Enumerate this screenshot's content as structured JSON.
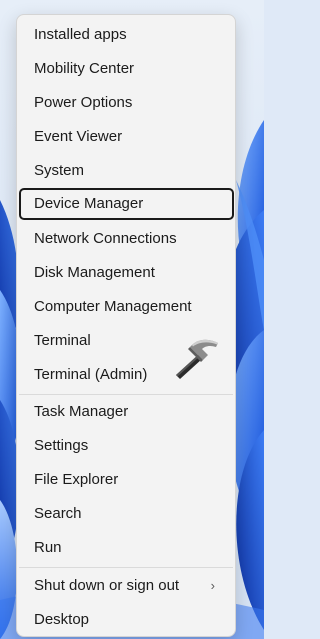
{
  "menu": {
    "items": [
      {
        "label": "Installed apps"
      },
      {
        "label": "Mobility Center"
      },
      {
        "label": "Power Options"
      },
      {
        "label": "Event Viewer"
      },
      {
        "label": "System"
      },
      {
        "label": "Device Manager",
        "focused": true
      },
      {
        "label": "Network Connections"
      },
      {
        "label": "Disk Management"
      },
      {
        "label": "Computer Management"
      },
      {
        "label": "Terminal"
      },
      {
        "label": "Terminal (Admin)"
      },
      {
        "label": "Task Manager"
      },
      {
        "label": "Settings"
      },
      {
        "label": "File Explorer"
      },
      {
        "label": "Search"
      },
      {
        "label": "Run"
      },
      {
        "label": "Shut down or sign out",
        "submenu": true
      },
      {
        "label": "Desktop"
      }
    ],
    "submenu_chevron": "›"
  },
  "icons": {
    "chevron": "chevron-right-icon",
    "logo": "hammer-logo-icon"
  }
}
